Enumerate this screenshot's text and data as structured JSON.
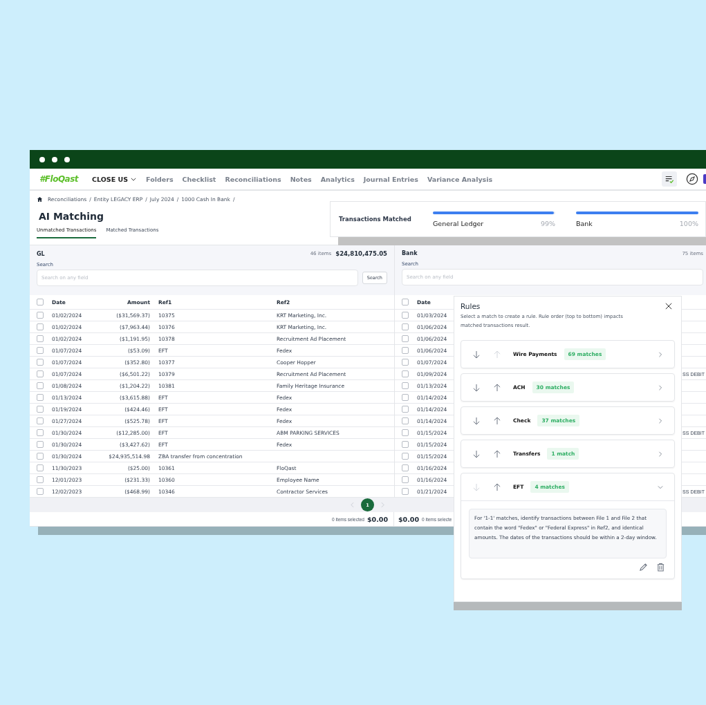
{
  "app": {
    "logo": "#FloQast",
    "entity": "CLOSE US",
    "nav": [
      "Folders",
      "Checklist",
      "Reconciliations",
      "Notes",
      "Analytics",
      "Journal Entries",
      "Variance Analysis"
    ]
  },
  "breadcrumb": {
    "separator": "/",
    "items": [
      "Reconciliations",
      "Entity LEGACY ERP",
      "July 2024",
      "1000 Cash In Bank"
    ]
  },
  "page_title": "AI Matching",
  "tabs": [
    {
      "label": "Unmatched Transactions",
      "selected": true
    },
    {
      "label": "Matched Transactions",
      "selected": false
    }
  ],
  "transactions_matched": {
    "title": "Transactions Matched",
    "meters": [
      {
        "label": "General Ledger",
        "reading": "99%",
        "level": 0.99
      },
      {
        "label": "Bank",
        "reading": "100%",
        "level": 1.0
      }
    ]
  },
  "gl": {
    "title": "GL",
    "count": "46 items",
    "total": "$24,810,475.05",
    "search_label": "Search",
    "search": {
      "placeholder": "Search on any field"
    },
    "search_button": "Search",
    "columns": [
      "Date",
      "Amount",
      "Ref1",
      "Ref2"
    ],
    "header_checked": false,
    "rows": [
      {
        "checked": false,
        "cells": [
          "01/02/2024",
          "($31,569.37)",
          "10375",
          "KRT Marketing, Inc."
        ]
      },
      {
        "checked": false,
        "cells": [
          "01/02/2024",
          "($7,963.44)",
          "10376",
          "KRT Marketing, Inc."
        ]
      },
      {
        "checked": false,
        "cells": [
          "01/02/2024",
          "($1,191.95)",
          "10378",
          "Recruitment Ad Placement"
        ]
      },
      {
        "checked": false,
        "cells": [
          "01/07/2024",
          "($53.09)",
          "EFT",
          "Fedex"
        ]
      },
      {
        "checked": false,
        "cells": [
          "01/07/2024",
          "($352.80)",
          "10377",
          "Cooper Hopper"
        ]
      },
      {
        "checked": false,
        "cells": [
          "01/07/2024",
          "($6,501.22)",
          "10379",
          "Recruitment Ad Placement"
        ]
      },
      {
        "checked": false,
        "cells": [
          "01/08/2024",
          "($1,204.22)",
          "10381",
          "Family Heritage Insurance"
        ]
      },
      {
        "checked": false,
        "cells": [
          "01/13/2024",
          "($3,615.88)",
          "EFT",
          "Fedex"
        ]
      },
      {
        "checked": false,
        "cells": [
          "01/19/2024",
          "($424.46)",
          "EFT",
          "Fedex"
        ]
      },
      {
        "checked": false,
        "cells": [
          "01/27/2024",
          "($525.78)",
          "EFT",
          "Fedex"
        ]
      },
      {
        "checked": false,
        "cells": [
          "01/30/2024",
          "($12,285.00)",
          "EFT",
          "ABM PARKING SERVICES"
        ]
      },
      {
        "checked": false,
        "cells": [
          "01/30/2024",
          "($3,427.62)",
          "EFT",
          "Fedex"
        ]
      },
      {
        "checked": false,
        "cells": [
          "01/30/2024",
          "$24,935,514.98",
          "ZBA transfer from concentration",
          ""
        ]
      },
      {
        "checked": false,
        "cells": [
          "11/30/2023",
          "($25.00)",
          "10361",
          "FloQast"
        ]
      },
      {
        "checked": false,
        "cells": [
          "12/01/2023",
          "($231.33)",
          "10360",
          "Employee Name"
        ]
      },
      {
        "checked": false,
        "cells": [
          "12/02/2023",
          "($468.99)",
          "10346",
          "Contractor Services"
        ]
      }
    ],
    "footer": {
      "selected": "0 items selected",
      "amount": "$0.00"
    }
  },
  "bank": {
    "title": "Bank",
    "count": "75 items",
    "search_label": "Search",
    "search": {
      "placeholder": "Search on any field"
    },
    "columns": [
      "Date"
    ],
    "header_checked": false,
    "rows": [
      {
        "checked": false,
        "date": "01/03/2024",
        "column_3": ""
      },
      {
        "checked": false,
        "date": "01/06/2024",
        "column_3": ""
      },
      {
        "checked": false,
        "date": "01/06/2024",
        "column_3": ""
      },
      {
        "checked": false,
        "date": "01/06/2024",
        "column_3": ""
      },
      {
        "checked": false,
        "date": "01/07/2024",
        "column_3": ""
      },
      {
        "checked": false,
        "date": "01/09/2024",
        "column_3": "SS DEBIT"
      },
      {
        "checked": false,
        "date": "01/13/2024",
        "column_3": ""
      },
      {
        "checked": false,
        "date": "01/14/2024",
        "column_3": ""
      },
      {
        "checked": false,
        "date": "01/14/2024",
        "column_3": ""
      },
      {
        "checked": false,
        "date": "01/14/2024",
        "column_3": ""
      },
      {
        "checked": false,
        "date": "01/15/2024",
        "column_3": "SS DEBIT"
      },
      {
        "checked": false,
        "date": "01/15/2024",
        "column_3": ""
      },
      {
        "checked": false,
        "date": "01/15/2024",
        "column_3": ""
      },
      {
        "checked": false,
        "date": "01/16/2024",
        "column_3": ""
      },
      {
        "checked": false,
        "date": "01/16/2024",
        "column_3": ""
      },
      {
        "checked": false,
        "date": "01/21/2024",
        "column_3": "SS DEBIT"
      }
    ],
    "footer": {
      "amount": "$0.00",
      "selected": "0 items selecte"
    }
  },
  "pagination": [
    {
      "label": "1",
      "selected": true
    }
  ],
  "rules": {
    "title": "Rules",
    "description": "Select a match to create a rule. Rule order (top to bottom) impacts matched transactions result.",
    "items": [
      {
        "name": "Wire Payments",
        "matches": "69 matches",
        "can_move_down": true,
        "can_move_up": false,
        "expanded": false
      },
      {
        "name": "ACH",
        "matches": "30 matches",
        "can_move_down": true,
        "can_move_up": true,
        "expanded": false
      },
      {
        "name": "Check",
        "matches": "37 matches",
        "can_move_down": true,
        "can_move_up": true,
        "expanded": false
      },
      {
        "name": "Transfers",
        "matches": "1 match",
        "can_move_down": true,
        "can_move_up": true,
        "expanded": false
      },
      {
        "name": "EFT",
        "matches": "4 matches",
        "can_move_down": false,
        "can_move_up": true,
        "expanded": true,
        "details": "For '1-1' matches, identify transactions between File 1 and File 2 that contain the word \"Fedex\" or \"Federal Express\" in Ref2, and identical amounts. The dates of the transactions should be within a 2-day window."
      }
    ]
  }
}
